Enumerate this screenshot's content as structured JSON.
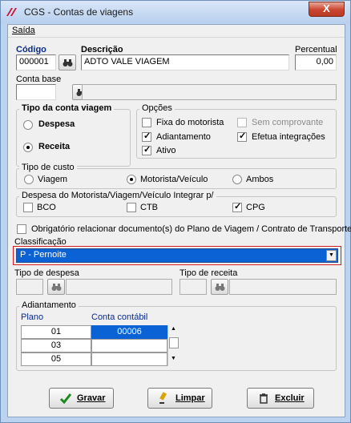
{
  "window": {
    "title": "CGS - Contas de viagens",
    "close_label": "X"
  },
  "menu": {
    "saida": "Saída"
  },
  "header": {
    "codigo_label": "Código",
    "codigo_value": "000001",
    "descricao_label": "Descrição",
    "descricao_value": "ADTO VALE VIAGEM",
    "percentual_label": "Percentual",
    "percentual_value": "0,00",
    "conta_base_label": "Conta base"
  },
  "tipo_conta": {
    "legend": "Tipo da conta viagem",
    "despesa": "Despesa",
    "receita": "Receita",
    "selected": "Receita"
  },
  "opcoes": {
    "legend": "Opções",
    "fixa_motorista": "Fixa do motorista",
    "sem_comprovante": "Sem comprovante",
    "adiantamento": "Adiantamento",
    "efetua_integracoes": "Efetua integrações",
    "ativo": "Ativo"
  },
  "tipo_custo": {
    "legend": "Tipo de custo",
    "viagem": "Viagem",
    "motorista_veiculo": "Motorista/Veículo",
    "ambos": "Ambos",
    "selected": "Motorista/Veículo"
  },
  "integrar": {
    "legend": "Despesa do Motorista/Viagem/Veículo Integrar p/",
    "bco": "BCO",
    "ctb": "CTB",
    "cpg": "CPG"
  },
  "obrigatorio": "Obrigatório relacionar documento(s) do Plano de Viagem / Contrato de Transporte",
  "classificacao": {
    "label": "Classificação",
    "value": "P - Pernoite"
  },
  "tipo_despesa_label": "Tipo de despesa",
  "tipo_receita_label": "Tipo de receita",
  "adiantamento": {
    "legend": "Adiantamento",
    "col_plano": "Plano",
    "col_conta": "Conta contábil",
    "rows": [
      {
        "plano": "01",
        "conta": "00006"
      },
      {
        "plano": "03",
        "conta": ""
      },
      {
        "plano": "05",
        "conta": ""
      }
    ]
  },
  "buttons": {
    "gravar": "Gravar",
    "limpar": "Limpar",
    "excluir": "Excluir"
  }
}
